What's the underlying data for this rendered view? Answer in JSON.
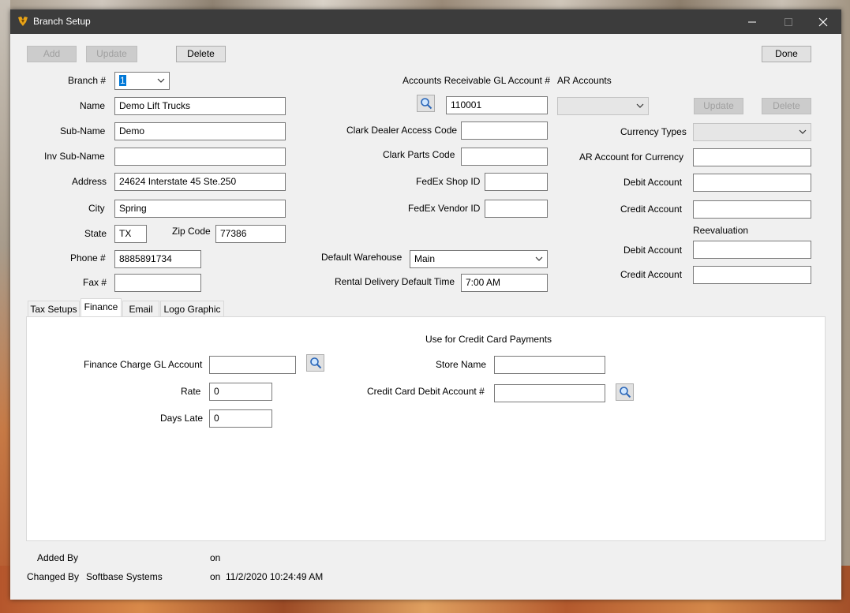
{
  "window": {
    "title": "Branch Setup"
  },
  "toolbar": {
    "add": "Add",
    "update": "Update",
    "delete": "Delete",
    "done": "Done"
  },
  "branch": {
    "branch_label": "Branch #",
    "branch_value": "1",
    "name_label": "Name",
    "name_value": "Demo Lift Trucks",
    "subname_label": "Sub-Name",
    "subname_value": "Demo",
    "inv_subname_label": "Inv Sub-Name",
    "inv_subname_value": "",
    "address_label": "Address",
    "address_value": "24624 Interstate 45 Ste.250",
    "city_label": "City",
    "city_value": "Spring",
    "state_label": "State",
    "state_value": "TX",
    "zip_label": "Zip Code",
    "zip_value": "77386",
    "phone_label": "Phone #",
    "phone_value": "8885891734",
    "fax_label": "Fax #",
    "fax_value": ""
  },
  "middle": {
    "ar_gl_label": "Accounts Receivable GL Account #",
    "ar_gl_value": "110001",
    "clark_dealer_label": "Clark Dealer Access Code",
    "clark_dealer_value": "",
    "clark_parts_label": "Clark Parts Code",
    "clark_parts_value": "",
    "fedex_shop_label": "FedEx Shop ID",
    "fedex_shop_value": "",
    "fedex_vendor_label": "FedEx Vendor ID",
    "fedex_vendor_value": "",
    "warehouse_label": "Default Warehouse",
    "warehouse_value": "Main",
    "rental_label": "Rental Delivery Default Time",
    "rental_value": "7:00 AM"
  },
  "ar_accounts": {
    "title": "AR Accounts",
    "select_value": "",
    "update": "Update",
    "delete": "Delete",
    "currency_types_label": "Currency Types",
    "currency_types_value": "",
    "ar_for_currency_label": "AR Account for Currency",
    "ar_for_currency_value": "",
    "debit_label": "Debit Account",
    "debit_value": "",
    "credit_label": "Credit Account",
    "credit_value": "",
    "reevaluation_label": "Reevaluation",
    "reeval_debit_label": "Debit Account",
    "reeval_debit_value": "",
    "reeval_credit_label": "Credit Account",
    "reeval_credit_value": ""
  },
  "tabs": [
    {
      "label": "Tax Setups"
    },
    {
      "label": "Finance"
    },
    {
      "label": "Email"
    },
    {
      "label": "Logo Graphic"
    }
  ],
  "finance": {
    "gl_label": "Finance Charge GL Account",
    "gl_value": "",
    "rate_label": "Rate",
    "rate_value": "0",
    "days_late_label": "Days Late",
    "days_late_value": "0",
    "cc_heading": "Use for Credit Card Payments",
    "store_label": "Store Name",
    "store_value": "",
    "cc_debit_label": "Credit Card Debit Account #",
    "cc_debit_value": ""
  },
  "footer": {
    "added_by_label": "Added By",
    "added_by_value": "",
    "added_on_label": "on",
    "added_on_value": "",
    "changed_by_label": "Changed By",
    "changed_by_value": "Softbase Systems",
    "changed_on_label": "on",
    "changed_on_value": "11/2/2020 10:24:49 AM"
  },
  "colors": {
    "titlebar": "#3c3c3c",
    "window_bg": "#f0f0f0",
    "selection": "#0078d7"
  }
}
